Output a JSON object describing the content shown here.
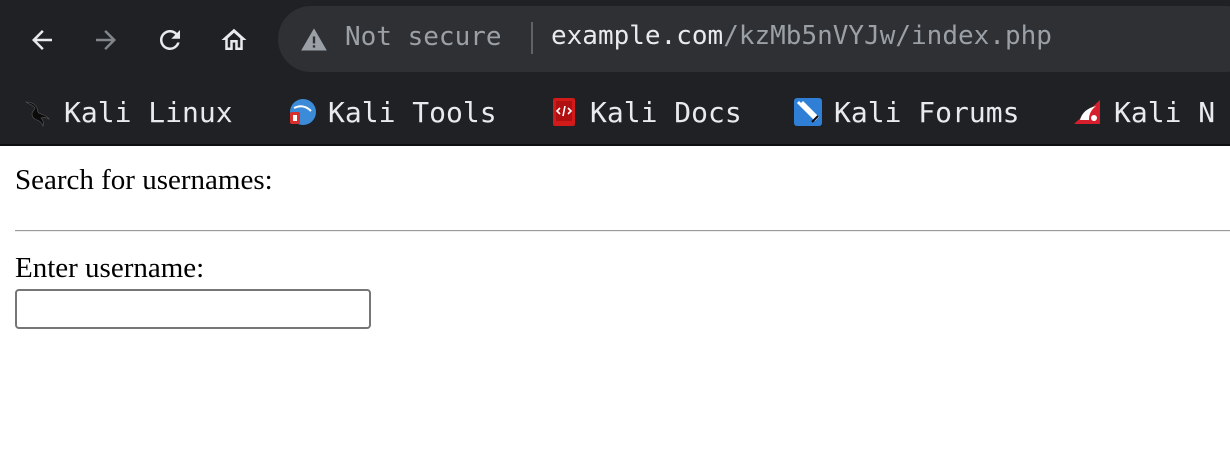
{
  "toolbar": {
    "security_label": "Not secure",
    "url_host": "example.com",
    "url_path": "/kzMb5nVYJw/index.php"
  },
  "bookmarks": [
    {
      "label": "Kali Linux",
      "icon": "kali-dragon-icon"
    },
    {
      "label": "Kali Tools",
      "icon": "kali-tools-icon"
    },
    {
      "label": "Kali Docs",
      "icon": "kali-docs-icon"
    },
    {
      "label": "Kali Forums",
      "icon": "kali-forums-icon"
    },
    {
      "label": "Kali N",
      "icon": "kali-nethunter-icon"
    }
  ],
  "page": {
    "heading": "Search for usernames:",
    "username_label": "Enter username:",
    "username_value": ""
  },
  "colors": {
    "chrome_bg": "#202124",
    "omnibox_bg": "#2e3034",
    "page_bg": "#ffffff"
  }
}
